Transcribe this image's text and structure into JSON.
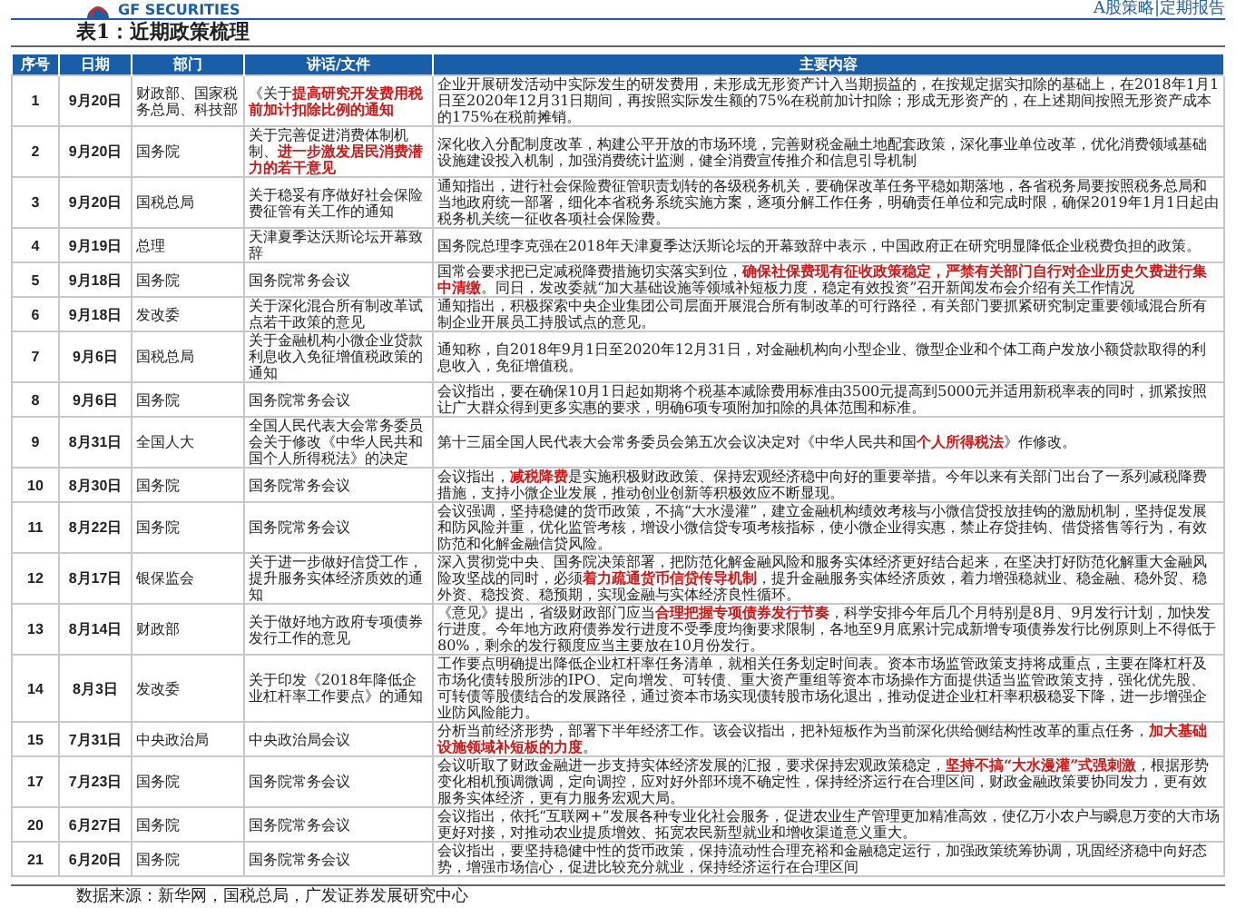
{
  "header": {
    "brand": "GF SECURITIES",
    "report_label": "A股策略|定期报告"
  },
  "title": "表1：近期政策梳理",
  "table": {
    "columns": [
      "序号",
      "日期",
      "部门",
      "讲话/文件",
      "主要内容"
    ],
    "rows": [
      {
        "index": "1",
        "date": "9月20日",
        "department": "财政部、国家税务总局、科技部",
        "document": "《关于**提高研究开发费用税前加计扣除比例的通知**",
        "content": "企业开展研发活动中实际发生的研发费用，未形成无形资产计入当期损益的，在按规定据实扣除的基础上，在2018年1月1日至2020年12月31日期间，再按照实际发生额的75%在税前加计扣除；形成无形资产的，在上述期间按照无形资产成本的175%在税前摊销。"
      },
      {
        "index": "2",
        "date": "9月20日",
        "department": "国务院",
        "document": "关于完善促进消费体制机制、**进一步激发居民消费潜力的若干意见**",
        "content": "深化收入分配制度改革，构建公平开放的市场环境，完善财税金融土地配套政策，深化事业单位改革，优化消费领域基础设施建设投入机制，加强消费统计监测，健全消费宣传推介和信息引导机制"
      },
      {
        "index": "3",
        "date": "9月20日",
        "department": "国税总局",
        "document": "关于稳妥有序做好社会保险费征管有关工作的通知",
        "content": "通知指出，进行社会保险费征管职责划转的各级税务机关，要确保改革任务平稳如期落地，各省税务局要按照税务总局和当地政府统一部署，细化本省税务系统实施方案，逐项分解工作任务，明确责任单位和完成时限，确保2019年1月1日起由税务机关统一征收各项社会保险费。"
      },
      {
        "index": "4",
        "date": "9月19日",
        "department": "总理",
        "document": "天津夏季达沃斯论坛开幕致辞",
        "content": "国务院总理李克强在2018年天津夏季达沃斯论坛的开幕致辞中表示，中国政府正在研究明显降低企业税费负担的政策。"
      },
      {
        "index": "5",
        "date": "9月18日",
        "department": "国务院",
        "document": "国务院常务会议",
        "content": "国常会要求把已定减税降费措施切实落实到位，**确保社保费现有征收政策稳定，严禁有关部门自行对企业历史欠费进行集中清缴**。同日，发改委就“加大基础设施等领域补短板力度，稳定有效投资”召开新闻发布会介绍有关工作情况"
      },
      {
        "index": "6",
        "date": "9月18日",
        "department": "发改委",
        "document": "关于深化混合所有制改革试点若干政策的意见",
        "content": "通知指出，积极探索中央企业集团公司层面开展混合所有制改革的可行路径，有关部门要抓紧研究制定重要领域混合所有制企业开展员工持股试点的意见。"
      },
      {
        "index": "7",
        "date": "9月6日",
        "department": "国税总局",
        "document": "关于金融机构小微企业贷款利息收入免征增值税政策的通知",
        "content": "通知称，自2018年9月1日至2020年12月31日，对金融机构向小型企业、微型企业和个体工商户发放小额贷款取得的利息收入，免征增值税。"
      },
      {
        "index": "8",
        "date": "9月6日",
        "department": "国务院",
        "document": "国务院常务会议",
        "content": "会议指出，要在确保10月1日起如期将个税基本减除费用标准由3500元提高到5000元并适用新税率表的同时，抓紧按照让广大群众得到更多实惠的要求，明确6项专项附加扣除的具体范围和标准。"
      },
      {
        "index": "9",
        "date": "8月31日",
        "department": "全国人大",
        "document": "全国人民代表大会常务委员会关于修改《中华人民共和国个人所得税法》的决定",
        "content": "第十三届全国人民代表大会常务委员会第五次会议决定对《中华人民共和国**个人所得税法**》作修改。"
      },
      {
        "index": "10",
        "date": "8月30日",
        "department": "国务院",
        "document": "国务院常务会议",
        "content": "会议指出，**减税降费**是实施积极财政政策、保持宏观经济稳中向好的重要举措。今年以来有关部门出台了一系列减税降费措施，支持小微企业发展，推动创业创新等积极效应不断显现。"
      },
      {
        "index": "11",
        "date": "8月22日",
        "department": "国务院",
        "document": "国务院常务会议",
        "content": "会议强调，坚持稳健的货币政策，不搞“大水漫灌”，建立金融机构绩效考核与小微信贷投放挂钩的激励机制，坚持促发展和防风险并重，优化监管考核，增设小微信贷专项考核指标，使小微企业得实惠，禁止存贷挂钩、借贷搭售等行为，有效防范和化解金融信贷风险。"
      },
      {
        "index": "12",
        "date": "8月17日",
        "department": "银保监会",
        "document": "关于进一步做好信贷工作，提升服务实体经济质效的通知",
        "content": "深入贯彻党中央、国务院决策部署，把防范化解金融风险和服务实体经济更好结合起来，在坚决打好防范化解重大金融风险攻坚战的同时，必须**着力疏通货币信贷传导机制**，提升金融服务实体经济质效，着力增强稳就业、稳金融、稳外贸、稳外资、稳投资、稳预期，实现金融与实体经济良性循环。"
      },
      {
        "index": "13",
        "date": "8月14日",
        "department": "财政部",
        "document": "关于做好地方政府专项债券发行工作的意见",
        "content": "《意见》提出，省级财政部门应当**合理把握专项债券发行节奏**，科学安排今年后几个月特别是8月、9月发行计划，加快发行进度。今年地方政府债券发行进度不受季度均衡要求限制，各地至9月底累计完成新增专项债券发行比例原则上不得低于80%，剩余的发行额度应当主要放在10月份发行。"
      },
      {
        "index": "14",
        "date": "8月3日",
        "department": "发改委",
        "document": "关于印发《2018年降低企业杠杆率工作要点》的通知",
        "content": "工作要点明确提出降低企业杠杆率任务清单，就相关任务划定时间表。资本市场监管政策支持将成重点，主要在降杠杆及市场化债转股所涉的IPO、定向增发、可转债、重大资产重组等资本市场操作方面提供适当监管政策支持，强化优先股、可转债等股债结合的发展路径，通过资本市场实现债转股市场化退出，推动促进企业杠杆率积极稳妥下降，进一步增强企业防风险能力。"
      },
      {
        "index": "15",
        "date": "7月31日",
        "department": "中央政治局",
        "document": "中央政治局会议",
        "content": "分析当前经济形势，部署下半年经济工作。该会议指出，把补短板作为当前深化供给侧结构性改革的重点任务，**加大基础设施领域补短板的力度**。"
      },
      {
        "index": "17",
        "date": "7月23日",
        "department": "国务院",
        "document": "国务院常务会议",
        "content": "会议听取了财政金融进一步支持实体经济发展的汇报，要求保持宏观政策稳定，**坚持不搞“大水漫灌”式强刺激**，根据形势变化相机预调微调，定向调控，应对好外部环境不确定性，保持经济运行在合理区间，财政金融政策要协同发力，更有效服务实体经济，更有力服务宏观大局。"
      },
      {
        "index": "20",
        "date": "6月27日",
        "department": "国务院",
        "document": "国务院常务会议",
        "content": "会议指出，依托“互联网+”发展各种专业化社会服务，促进农业生产管理更加精准高效，使亿万小农户与瞬息万变的大市场更好对接，对推动农业提质增效、拓宽农民新型就业和增收渠道意义重大。"
      },
      {
        "index": "21",
        "date": "6月20日",
        "department": "国务院",
        "document": "国务院常务会议",
        "content": "会议指出，要坚持稳健中性的货币政策，保持流动性合理充裕和金融稳定运行，加强政策统筹协调，巩固经济稳中向好态势，增强市场信心，促进比较充分就业，保持经济运行在合理区间"
      }
    ]
  },
  "source": "数据来源：新华网，国税总局，广发证券发展研究中心"
}
